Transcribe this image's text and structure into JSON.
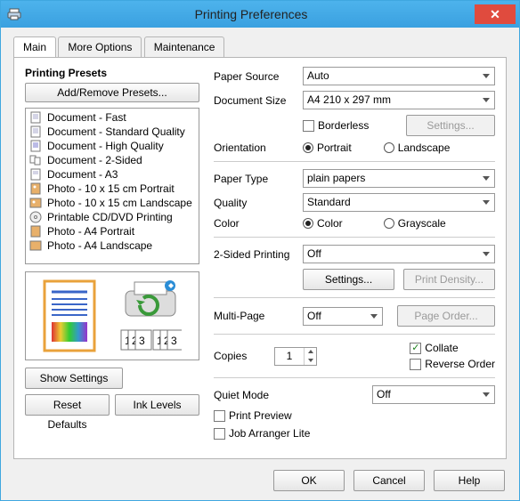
{
  "window": {
    "title": "Printing Preferences"
  },
  "tabs": {
    "main": "Main",
    "more": "More Options",
    "maint": "Maintenance"
  },
  "left": {
    "heading": "Printing Presets",
    "add_remove": "Add/Remove Presets...",
    "presets": [
      "Document - Fast",
      "Document - Standard Quality",
      "Document - High Quality",
      "Document - 2-Sided",
      "Document - A3",
      "Photo - 10 x 15 cm Portrait",
      "Photo - 10 x 15 cm Landscape",
      "Printable CD/DVD Printing",
      "Photo - A4 Portrait",
      "Photo - A4 Landscape"
    ],
    "show_settings": "Show Settings",
    "reset_defaults": "Reset Defaults",
    "ink_levels": "Ink Levels"
  },
  "right": {
    "paper_source": {
      "label": "Paper Source",
      "value": "Auto"
    },
    "document_size": {
      "label": "Document Size",
      "value": "A4 210 x 297 mm"
    },
    "borderless": {
      "label": "Borderless",
      "settings_btn": "Settings..."
    },
    "orientation": {
      "label": "Orientation",
      "portrait": "Portrait",
      "landscape": "Landscape"
    },
    "paper_type": {
      "label": "Paper Type",
      "value": "plain papers"
    },
    "quality": {
      "label": "Quality",
      "value": "Standard"
    },
    "color": {
      "label": "Color",
      "opt_color": "Color",
      "opt_gray": "Grayscale"
    },
    "two_sided": {
      "label": "2-Sided Printing",
      "value": "Off",
      "settings_btn": "Settings...",
      "density_btn": "Print Density..."
    },
    "multi_page": {
      "label": "Multi-Page",
      "value": "Off",
      "page_order_btn": "Page Order..."
    },
    "copies": {
      "label": "Copies",
      "value": "1",
      "collate": "Collate",
      "reverse": "Reverse Order"
    },
    "quiet_mode": {
      "label": "Quiet Mode",
      "value": "Off"
    },
    "print_preview": "Print Preview",
    "job_arranger": "Job Arranger Lite"
  },
  "footer": {
    "ok": "OK",
    "cancel": "Cancel",
    "help": "Help"
  }
}
